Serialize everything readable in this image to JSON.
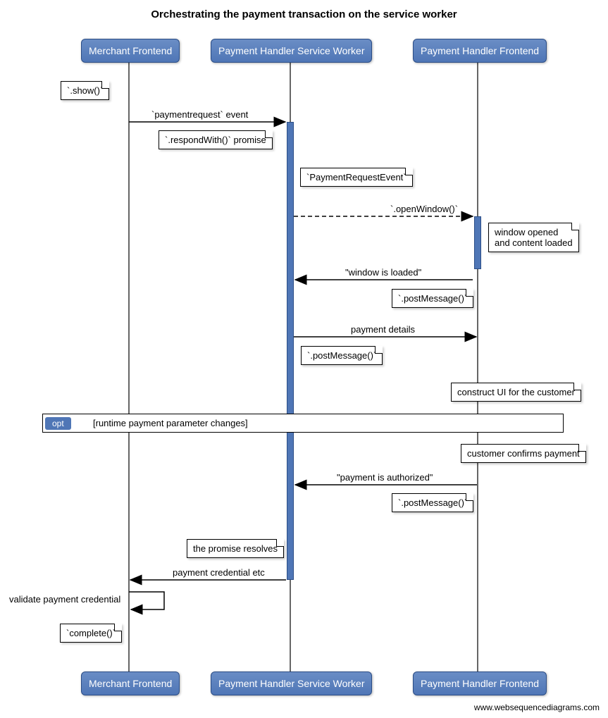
{
  "title": "Orchestrating the payment transaction on the service worker",
  "actors": {
    "a": "Merchant Frontend",
    "b": "Payment Handler Service Worker",
    "c": "Payment Handler Frontend"
  },
  "notes": {
    "show": "`.show()`",
    "respondWith": "`.respondWith()` promise",
    "pre": "`PaymentRequestEvent`",
    "windowOpened1": "window opened",
    "windowOpened2": "and content loaded",
    "postMsg1": "`.postMessage()`",
    "postMsg2": "`.postMessage()`",
    "constructUI": "construct UI for the customer",
    "customerConfirms": "customer confirms payment",
    "postMsg3": "`.postMessage()`",
    "promiseResolves": "the promise resolves",
    "complete": "`complete()`"
  },
  "messages": {
    "paymentRequest": "`paymentrequest` event",
    "openWindow": "`.openWindow()`",
    "windowLoaded": "\"window is loaded\"",
    "paymentDetails": "payment details",
    "paymentAuthorized": "\"payment is authorized\"",
    "paymentCredential": "payment credential etc",
    "validate": "validate payment credential"
  },
  "opt": {
    "label": "opt",
    "guard": "[runtime payment parameter changes]"
  },
  "attribution": "www.websequencediagrams.com"
}
